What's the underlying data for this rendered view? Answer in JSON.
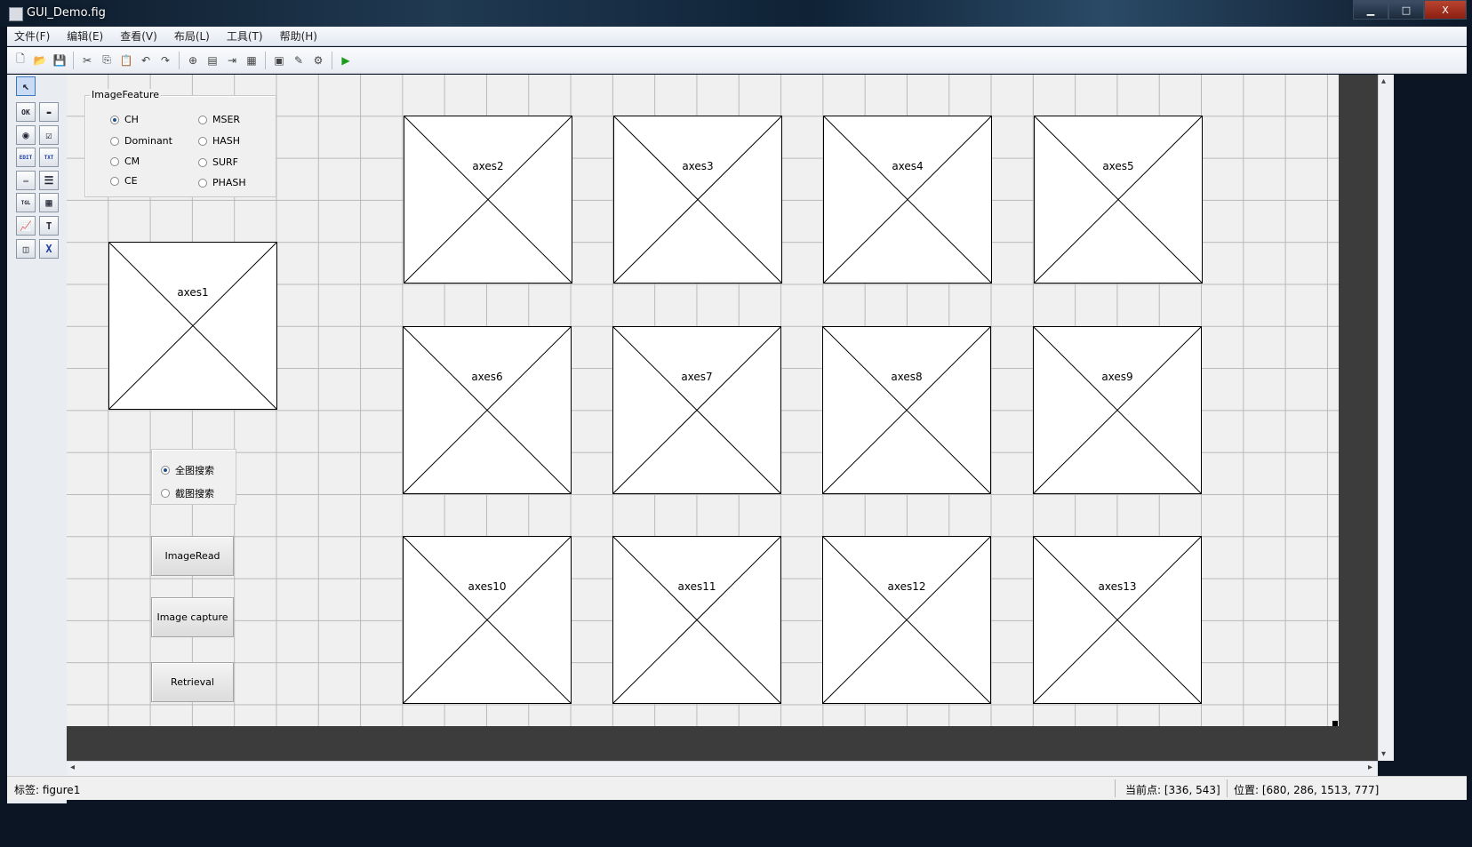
{
  "window": {
    "title": "GUI_Demo.fig",
    "controls": {
      "minimize": "▁",
      "maximize": "□",
      "close": "X"
    }
  },
  "menu": [
    "文件(F)",
    "编辑(E)",
    "查看(V)",
    "布局(L)",
    "工具(T)",
    "帮助(H)"
  ],
  "toolbar": {
    "icons": [
      "new-file-icon",
      "open-folder-icon",
      "save-icon",
      "cut-icon",
      "copy-icon",
      "paste-icon",
      "undo-icon",
      "redo-icon",
      "align-icon",
      "menu-editor-icon",
      "tab-order-icon",
      "toolbar-editor-icon",
      "mfile-editor-icon",
      "property-inspector-icon",
      "object-browser-icon",
      "run-figure-icon"
    ],
    "glyphs": [
      "🗋",
      "📂",
      "💾",
      "✂",
      "⎘",
      "📋",
      "↶",
      "↷",
      "⊕",
      "▤",
      "⇥",
      "▦",
      "▣",
      "✎",
      "⚙",
      "▶"
    ]
  },
  "palette": [
    {
      "name": "select-tool",
      "label": "↖"
    },
    {
      "name": "pushbutton-tool",
      "label": "OK"
    },
    {
      "name": "slider-tool",
      "label": "▬"
    },
    {
      "name": "radiobutton-tool",
      "label": "◉"
    },
    {
      "name": "checkbox-tool",
      "label": "☑"
    },
    {
      "name": "edit-text-tool",
      "label": "EDIT"
    },
    {
      "name": "static-text-tool",
      "label": "TXT"
    },
    {
      "name": "popup-menu-tool",
      "label": "▭"
    },
    {
      "name": "listbox-tool",
      "label": "☰"
    },
    {
      "name": "toggle-button-tool",
      "label": "TGL"
    },
    {
      "name": "table-tool",
      "label": "▦"
    },
    {
      "name": "axes-tool",
      "label": "📈"
    },
    {
      "name": "panel-tool",
      "label": "T"
    },
    {
      "name": "button-group-tool",
      "label": "◫"
    },
    {
      "name": "activex-tool",
      "label": "X"
    }
  ],
  "image_feature_panel": {
    "title": "ImageFeature",
    "options": [
      {
        "label": "CH",
        "selected": true
      },
      {
        "label": "Dominant",
        "selected": false
      },
      {
        "label": "CM",
        "selected": false
      },
      {
        "label": "CE",
        "selected": false
      },
      {
        "label": "MSER",
        "selected": false
      },
      {
        "label": "HASH",
        "selected": false
      },
      {
        "label": "SURF",
        "selected": false
      },
      {
        "label": "PHASH",
        "selected": false
      }
    ]
  },
  "search_group": {
    "options": [
      {
        "label": "全图搜索",
        "selected": true
      },
      {
        "label": "截图搜索",
        "selected": false
      }
    ]
  },
  "buttons": {
    "image_read": "ImageRead",
    "image_capture": "Image capture",
    "retrieval": "Retrieval"
  },
  "axes": [
    "axes1",
    "axes2",
    "axes3",
    "axes4",
    "axes5",
    "axes6",
    "axes7",
    "axes8",
    "axes9",
    "axes10",
    "axes11",
    "axes12",
    "axes13"
  ],
  "status": {
    "tag": "标签: figure1",
    "current_point": "当前点:  [336, 543]",
    "position": "位置: [680, 286, 1513, 777]"
  }
}
